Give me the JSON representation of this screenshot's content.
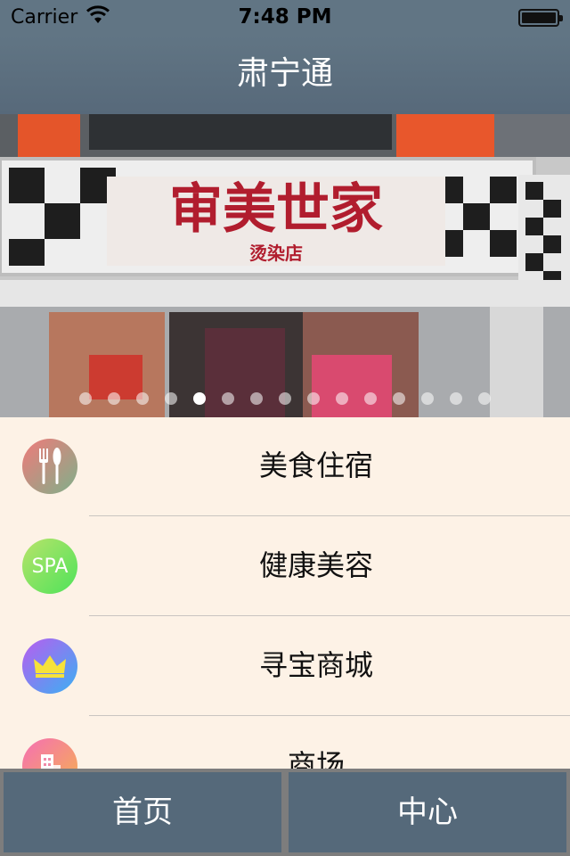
{
  "status_bar": {
    "carrier": "Carrier",
    "time": "7:48 PM",
    "wifi_icon": "wifi-icon",
    "battery_icon": "battery-icon"
  },
  "nav": {
    "title": "肃宁通"
  },
  "banner": {
    "sign_text": "审美世家",
    "sign_subtext": "烫染店",
    "page_count": 15,
    "active_page_index": 4
  },
  "menu": {
    "items": [
      {
        "label": "美食住宿",
        "icon": "fork-knife-icon",
        "badge": ""
      },
      {
        "label": "健康美容",
        "icon": "spa-icon",
        "badge": "SPA"
      },
      {
        "label": "寻宝商城",
        "icon": "crown-icon",
        "badge": ""
      },
      {
        "label": "商场",
        "icon": "building-icon",
        "badge": ""
      }
    ]
  },
  "tabs": {
    "home": "首页",
    "center": "中心"
  },
  "colors": {
    "bar": "#55697a",
    "background": "#fdf2e6"
  }
}
